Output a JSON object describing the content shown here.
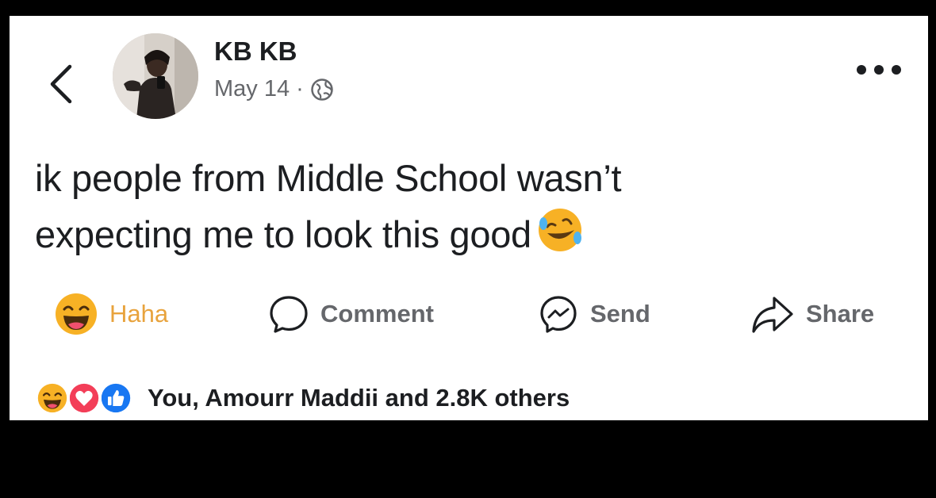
{
  "post": {
    "author": "KB KB",
    "date": "May 14",
    "separator": "·",
    "privacy_icon": "globe-icon",
    "text_line1": "ik people from Middle School wasn’t",
    "text_line2": "expecting me to look this good",
    "emoji": "rolling-on-floor-laughing-emoji"
  },
  "actions": {
    "reaction_label": "Haha",
    "comment_label": "Comment",
    "send_label": "Send",
    "share_label": "Share"
  },
  "reactions": {
    "icons": [
      "haha-icon",
      "love-icon",
      "like-icon"
    ],
    "summary": "You, Amourr Maddii and 2.8K others"
  },
  "colors": {
    "haha_yellow": "#f7b125",
    "love_red": "#f33e58",
    "like_blue": "#1877f2",
    "secondary_text": "#65676b",
    "primary_text": "#1c1e21"
  }
}
